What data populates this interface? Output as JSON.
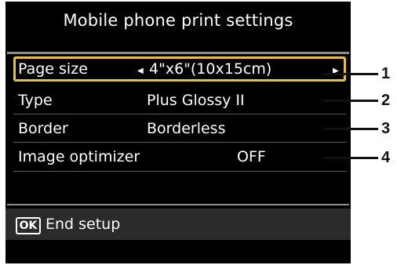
{
  "screen": {
    "title": "Mobile phone print settings",
    "settings": [
      {
        "label": "Page size",
        "value": "4\"x6\"(10x15cm)",
        "selected": true
      },
      {
        "label": "Type",
        "value": "Plus Glossy II",
        "selected": false
      },
      {
        "label": "Border",
        "value": "Borderless",
        "selected": false
      },
      {
        "label": "Image optimizer",
        "value": "OFF",
        "selected": false
      }
    ],
    "footer": {
      "ok_label": "OK",
      "text": "End setup"
    }
  },
  "callouts": [
    "1",
    "2",
    "3",
    "4"
  ],
  "colors": {
    "selection": "#e8c233",
    "background": "#000000",
    "footer": "#2b2b2b"
  }
}
